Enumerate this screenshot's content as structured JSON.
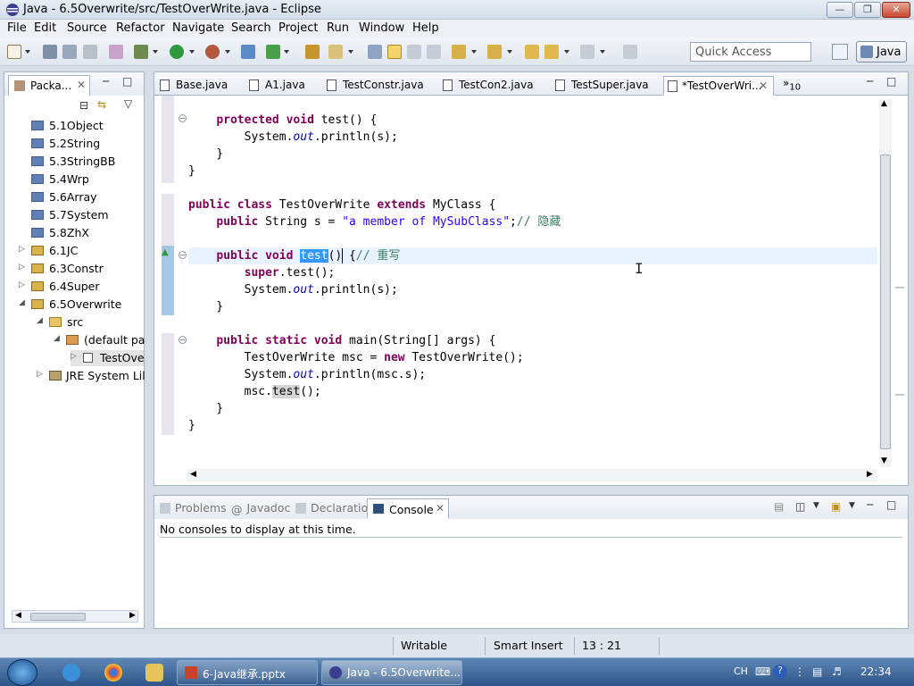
{
  "window": {
    "title": "Java - 6.5Overwrite/src/TestOverWrite.java - Eclipse"
  },
  "menubar": [
    "File",
    "Edit",
    "Source",
    "Refactor",
    "Navigate",
    "Search",
    "Project",
    "Run",
    "Window",
    "Help"
  ],
  "toolbar": {
    "quick_access_placeholder": "Quick Access",
    "perspective": "Java"
  },
  "package_explorer": {
    "tab_label": "Packa...",
    "tree": [
      {
        "label": "5.1Object",
        "kind": "package"
      },
      {
        "label": "5.2String",
        "kind": "package"
      },
      {
        "label": "5.3StringBB",
        "kind": "package"
      },
      {
        "label": "5.4Wrp",
        "kind": "package"
      },
      {
        "label": "5.6Array",
        "kind": "package"
      },
      {
        "label": "5.7System",
        "kind": "package"
      },
      {
        "label": "5.8ZhX",
        "kind": "package"
      },
      {
        "label": "6.1JC",
        "kind": "project"
      },
      {
        "label": "6.3Constr",
        "kind": "project"
      },
      {
        "label": "6.4Super",
        "kind": "project"
      },
      {
        "label": "6.5Overwrite",
        "kind": "project"
      },
      {
        "label": "src",
        "kind": "folder"
      },
      {
        "label": "(default pa",
        "kind": "default-package"
      },
      {
        "label": "TestOve",
        "kind": "java-file"
      },
      {
        "label": "JRE System Lil",
        "kind": "library"
      }
    ]
  },
  "editor": {
    "tabs": [
      {
        "label": "Base.java",
        "active": false
      },
      {
        "label": "A1.java",
        "active": false
      },
      {
        "label": "TestConstr.java",
        "active": false
      },
      {
        "label": "TestCon2.java",
        "active": false
      },
      {
        "label": "TestSuper.java",
        "active": false
      },
      {
        "label": "*TestOverWri...",
        "active": true
      }
    ],
    "overflow_count": "10",
    "code_lines": [
      "    protected void test() {",
      "        System.out.println(s);",
      "    }",
      "}",
      "",
      "public class TestOverWrite extends MyClass {",
      "    public String s = \"a member of MySubClass\";// 隐藏",
      "",
      "    public void test() {// 重写",
      "        super.test();",
      "        System.out.println(s);",
      "    }",
      "",
      "    public static void main(String[] args) {",
      "        TestOverWrite msc = new TestOverWrite();",
      "        System.out.println(msc.s);",
      "        msc.test();",
      "    }",
      "}"
    ]
  },
  "console": {
    "tabs": [
      "Problems",
      "Javadoc",
      "Declaration",
      "Console"
    ],
    "active_tab": "Console",
    "message": "No consoles to display at this time."
  },
  "statusbar": {
    "mode": "Writable",
    "insert": "Smart Insert",
    "position": "13 : 21"
  },
  "taskbar": {
    "buttons": [
      "6-Java继承.pptx",
      "Java - 6.5Overwrite..."
    ],
    "tray_lang": "CH",
    "clock": "22:34"
  }
}
